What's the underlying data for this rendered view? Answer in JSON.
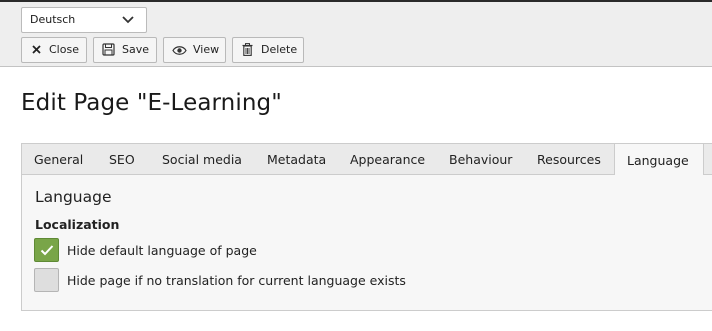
{
  "toolbar": {
    "language_select": {
      "value": "Deutsch"
    },
    "buttons": {
      "close": "Close",
      "save": "Save",
      "view": "View",
      "delete": "Delete"
    }
  },
  "page": {
    "title": "Edit Page \"E-Learning\""
  },
  "tabs": [
    {
      "label": "General"
    },
    {
      "label": "SEO"
    },
    {
      "label": "Social media"
    },
    {
      "label": "Metadata"
    },
    {
      "label": "Appearance"
    },
    {
      "label": "Behaviour"
    },
    {
      "label": "Resources"
    },
    {
      "label": "Language",
      "active": true
    }
  ],
  "panel": {
    "section_title": "Language",
    "group_label": "Localization",
    "options": [
      {
        "label": "Hide default language of page",
        "checked": true
      },
      {
        "label": "Hide page if no translation for current language exists",
        "checked": false
      }
    ]
  },
  "colors": {
    "checkbox_checked": "#79a548",
    "toolbar_bg": "#eeeeee",
    "panel_bg": "#f7f7f7"
  },
  "icons": {
    "close": "close-icon",
    "save": "save-icon",
    "view": "eye-icon",
    "delete": "trash-icon",
    "select": "chevron-down-icon",
    "checkbox": "check-icon"
  }
}
